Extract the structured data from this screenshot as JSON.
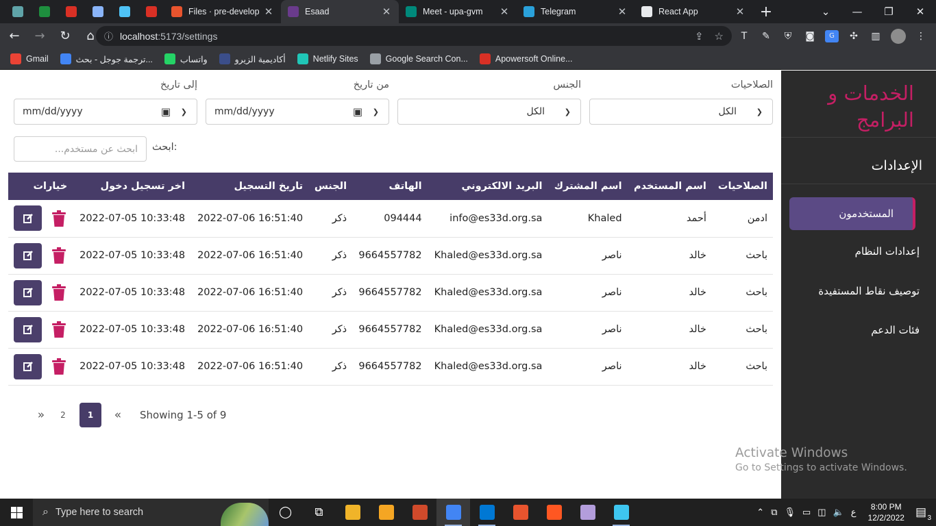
{
  "browser": {
    "tabs": [
      {
        "title": "Files · pre-developm",
        "fav_color": "#e8542e",
        "active": false
      },
      {
        "title": "Esaad",
        "fav_color": "#6a3b8c",
        "active": true
      },
      {
        "title": "Meet - upa-gvm",
        "fav_color": "#00897b",
        "active": false
      },
      {
        "title": "Telegram",
        "fav_color": "#2aa1da",
        "active": false
      },
      {
        "title": "React App",
        "fav_color": "#e8eaed",
        "active": false
      }
    ],
    "pinned_colors": [
      "#5fa3a8",
      "#1e8e3e",
      "#d93025",
      "#8ab4f8",
      "#4fc3f7",
      "#d93025"
    ],
    "url_host": "localhost",
    "url_path": ":5173/settings",
    "bookmarks": [
      {
        "label": "Gmail",
        "color": "#ea4335"
      },
      {
        "label": "ترجمة جوجل - بحث...",
        "color": "#4285f4"
      },
      {
        "label": "واتساب",
        "color": "#25d366"
      },
      {
        "label": "أكاديمية الزيرو",
        "color": "#3b4e8a"
      },
      {
        "label": "Netlify Sites",
        "color": "#20c6b7"
      },
      {
        "label": "Google Search Con...",
        "color": "#9aa0a6"
      },
      {
        "label": "Apowersoft Online...",
        "color": "#d93025"
      }
    ]
  },
  "sidebar": {
    "brand": "الخدمات و البرامج",
    "section_title": "الإعدادات",
    "items": [
      {
        "label": "المستخدمون",
        "active": true
      },
      {
        "label": "إعدادات النظام",
        "active": false
      },
      {
        "label": "توصيف نقاط المستفيدة",
        "active": false
      },
      {
        "label": "فئات الدعم",
        "active": false
      }
    ]
  },
  "filters": {
    "permissions": {
      "label": "الصلاحيات",
      "value": "الكل"
    },
    "gender": {
      "label": "الجنس",
      "value": "الكل"
    },
    "from_date": {
      "label": "من تاريخ",
      "value": "mm/dd/yyyy"
    },
    "to_date": {
      "label": "إلى تاريخ",
      "value": "mm/dd/yyyy"
    },
    "search_label": "ابحث:",
    "search_placeholder": "ابحث عن مستخدم..."
  },
  "table": {
    "headers": [
      "الصلاحيات",
      "اسم المستخدم",
      "اسم المشترك",
      "البريد الالكتروني",
      "الهاتف",
      "الجنس",
      "تاريخ التسجيل",
      "اخر تسجيل دخول",
      "خيارات"
    ],
    "rows": [
      [
        "ادمن",
        "أحمد",
        "Khaled",
        "info@es33d.org.sa",
        "094444",
        "ذكر",
        "2022-07-06 16:51:40",
        "2022-07-05 10:33:48"
      ],
      [
        "باحث",
        "خالد",
        "ناصر",
        "Khaled@es33d.org.sa",
        "9664557782",
        "ذكر",
        "2022-07-06 16:51:40",
        "2022-07-05 10:33:48"
      ],
      [
        "باحث",
        "خالد",
        "ناصر",
        "Khaled@es33d.org.sa",
        "9664557782",
        "ذكر",
        "2022-07-06 16:51:40",
        "2022-07-05 10:33:48"
      ],
      [
        "باحث",
        "خالد",
        "ناصر",
        "Khaled@es33d.org.sa",
        "9664557782",
        "ذكر",
        "2022-07-06 16:51:40",
        "2022-07-05 10:33:48"
      ],
      [
        "باحث",
        "خالد",
        "ناصر",
        "Khaled@es33d.org.sa",
        "9664557782",
        "ذكر",
        "2022-07-06 16:51:40",
        "2022-07-05 10:33:48"
      ]
    ]
  },
  "pagination": {
    "next_label": "»",
    "prev_label": "«",
    "pages": [
      "2",
      "1"
    ],
    "current": "1",
    "info": "Showing 1-5 of 9"
  },
  "watermark": {
    "line1": "Activate Windows",
    "line2": "Go to Settings to activate Windows."
  },
  "taskbar": {
    "search_placeholder": "Type here to search",
    "time": "8:00 PM",
    "date": "12/2/2022",
    "lang": "ع",
    "notifications": "3",
    "app_colors": [
      "#ffffff",
      "#ffffff",
      "#f0b429",
      "#f5a623",
      "#d04a2b",
      "#4285f4",
      "#0078d4",
      "#e8542e",
      "#ff5722",
      "#b39ddb",
      "#3ec6f0"
    ]
  }
}
